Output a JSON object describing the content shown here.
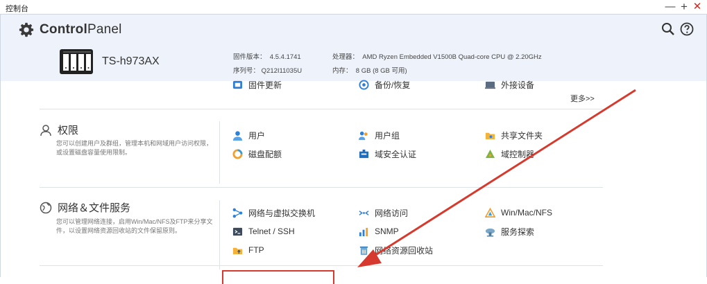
{
  "window": {
    "title": "控制台",
    "min_label": "—",
    "max_label": "+",
    "close_label": "✕"
  },
  "header": {
    "brand_bold": "Control",
    "brand_rest": "Panel",
    "icons": {
      "search": "search-icon",
      "help": "help-icon"
    },
    "device": {
      "model": "TS-h973AX",
      "firmware_label": "固件版本：",
      "firmware_value": "4.5.4.1741",
      "serial_label": "序列号：",
      "serial_value": "Q212I11035U",
      "cpu_label": "处理器：",
      "cpu_value": "AMD Ryzen Embedded V1500B Quad-core CPU @ 2.20GHz",
      "mem_label": "内存：",
      "mem_value": "8 GB (8 GB 可用)"
    }
  },
  "system_row": {
    "items": [
      "固件更新",
      "备份/恢复",
      "外接设备"
    ],
    "more": "更多>>"
  },
  "sections": [
    {
      "title": "权限",
      "icon": "user-icon",
      "description": "您可以创建用户及群组，管理本机和网域用户访问权限，或设置磁盘容量使用限制。",
      "items": [
        "用户",
        "用户组",
        "共享文件夹",
        "磁盘配额",
        "域安全认证",
        "域控制器"
      ]
    },
    {
      "title": "网络＆文件服务",
      "icon": "globe-icon",
      "description": "您可以管理网络连接，启用Win/Mac/NFS及FTP来分享文件，以设置网络资源回收站的文件保留原则。",
      "items": [
        "网络与虚拟交换机",
        "网络访问",
        "Win/Mac/NFS",
        "Telnet / SSH",
        "SNMP",
        "服务探索",
        "FTP",
        "网络资源回收站"
      ]
    }
  ],
  "colors": {
    "header_bg": "#eef3fb",
    "annotation_red": "#d63a2e",
    "divider": "#dde2e8"
  }
}
